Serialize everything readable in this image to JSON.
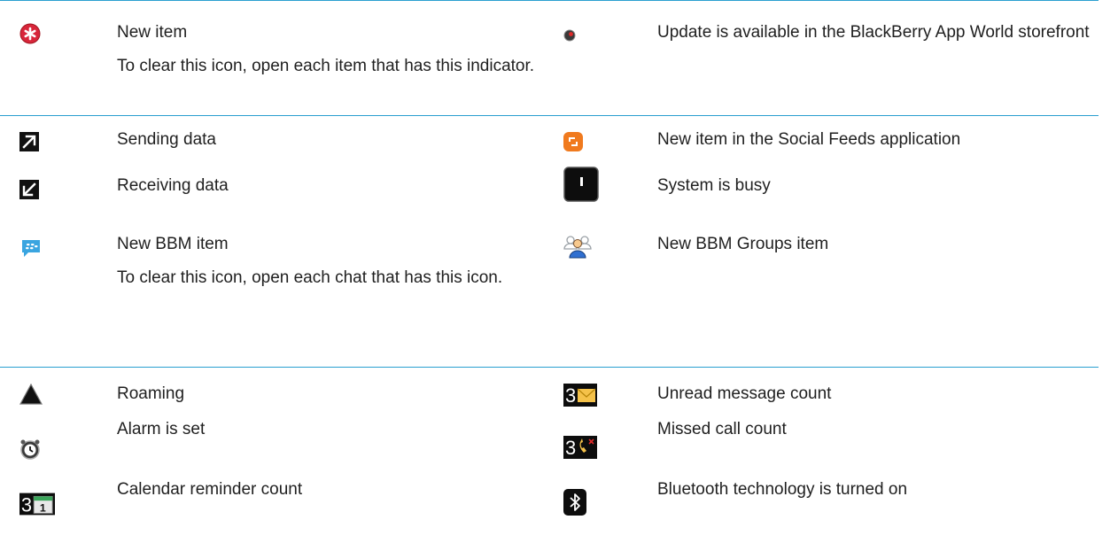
{
  "rows": [
    {
      "left": {
        "icon": "new-item-red-asterisk-icon",
        "title": "New item",
        "note": "To clear this icon, open each item that has this indicator."
      },
      "right": {
        "icon": "app-world-update-icon",
        "title": "Update is available in the BlackBerry App World storefront",
        "note": ""
      }
    },
    {
      "left": {
        "icon": "sending-data-arrow-icon",
        "title": "Sending data",
        "note": ""
      },
      "right": {
        "icon": "social-feeds-icon",
        "title": "New item in the Social Feeds application",
        "note": ""
      }
    },
    {
      "left": {
        "icon": "receiving-data-arrow-icon",
        "title": "Receiving data",
        "note": ""
      },
      "right": {
        "icon": "system-busy-icon",
        "title": "System is busy",
        "note": ""
      }
    },
    {
      "left": {
        "icon": "bbm-chat-bubble-icon",
        "title": "New BBM item",
        "note": "To clear this icon, open each chat that has this icon."
      },
      "right": {
        "icon": "bbm-groups-icon",
        "title": "New BBM Groups item",
        "note": ""
      }
    },
    {
      "left": {
        "icon": "roaming-triangle-icon",
        "title": "Roaming",
        "note": ""
      },
      "right": {
        "icon": "unread-message-count-icon",
        "title": "Unread message count",
        "note": ""
      }
    },
    {
      "left": {
        "icon": "alarm-clock-icon",
        "title": "Alarm is set",
        "note": ""
      },
      "right": {
        "icon": "missed-call-count-icon",
        "title": "Missed call count",
        "note": ""
      }
    },
    {
      "left": {
        "icon": "calendar-reminder-count-icon",
        "title": "Calendar reminder count",
        "note": ""
      },
      "right": {
        "icon": "bluetooth-icon",
        "title": "Bluetooth technology is turned on",
        "note": ""
      }
    }
  ],
  "count_digit": "3",
  "calendar_day": "1",
  "colors": {
    "rule": "#2a9fd0",
    "red": "#d8263a",
    "orange": "#f07a1e",
    "bbm_blue": "#3aa5e0",
    "envelope": "#f5c24a"
  }
}
